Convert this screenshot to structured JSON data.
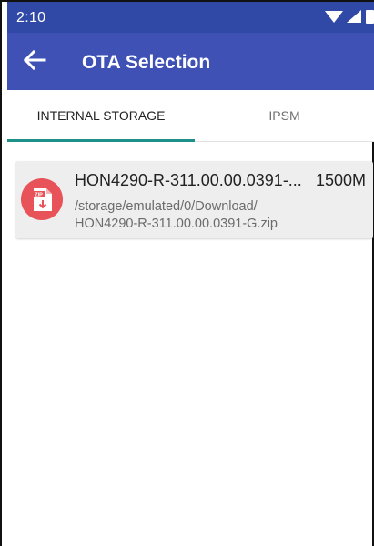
{
  "status_bar": {
    "time": "2:10",
    "icons": [
      "wifi-icon",
      "cell-signal-icon",
      "battery-icon"
    ]
  },
  "app_bar": {
    "title": "OTA Selection",
    "back_icon": "arrow-back-icon"
  },
  "tabs": [
    {
      "label": "INTERNAL STORAGE",
      "selected": true
    },
    {
      "label": "IPSM",
      "selected": false
    }
  ],
  "files": [
    {
      "name": "HON4290-R-311.00.00.0391-...",
      "size": "1500M",
      "path": "/storage/emulated/0/Download/\nHON4290-R-311.00.00.0391-G.zip",
      "icon": "zip-file-icon",
      "icon_label": "ZIP"
    }
  ],
  "colors": {
    "status_bar": "#3048a6",
    "app_bar": "#3f51b5",
    "tab_indicator": "#1f8f8a",
    "zip_icon": "#e8535a"
  }
}
